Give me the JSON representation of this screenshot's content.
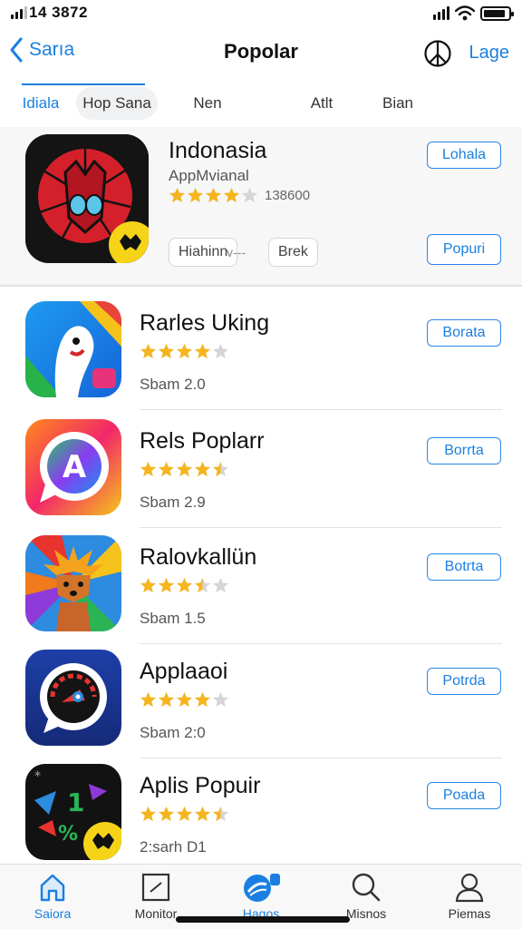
{
  "status_bar": {
    "time": "14 3872",
    "signal_icon": "cellular-icon",
    "wifi_icon": "wifi-icon",
    "battery_icon": "battery-icon",
    "battery_level": 0.9
  },
  "nav": {
    "back_label": "Sarıa",
    "title": "Popolar",
    "right_icon": "peace-icon",
    "right_label": "Lage"
  },
  "tabs": [
    {
      "label": "Idiala",
      "active": true
    },
    {
      "label": "Hop Sana",
      "active": false
    },
    {
      "label": "Nen",
      "active": false
    },
    {
      "label": "Atlt",
      "active": false
    },
    {
      "label": "Bian",
      "active": false
    }
  ],
  "featured": {
    "name": "Indonasia",
    "subtitle": "AppMvianal",
    "rating": 4,
    "rating_count": "138600",
    "chip_1": "Hiahinn",
    "chip_2": "v---",
    "chip_3": "Brek",
    "button_top": "Lohala",
    "button_bottom": "Popuri"
  },
  "apps": [
    {
      "name": "Rarles Uking",
      "rating": 4,
      "meta": "Sbam 2.0",
      "button": "Borata",
      "icon": "ghost-app-icon"
    },
    {
      "name": "Rels Poplarr",
      "rating": 4.5,
      "meta": "Sbam 2.9",
      "button": "Borrta",
      "icon": "chat-a-app-icon"
    },
    {
      "name": "Ralovkallün",
      "rating": 3.5,
      "meta": "Sbam 1.5",
      "button": "Botrta",
      "icon": "fox-app-icon"
    },
    {
      "name": "Applaaoi",
      "rating": 4,
      "meta": "Sbam 2:0",
      "button": "Potrda",
      "icon": "speedometer-app-icon"
    },
    {
      "name": "Aplis Popuir",
      "rating": 4.5,
      "meta": "2:sarh D1",
      "button": "Poada",
      "icon": "game-app-icon"
    }
  ],
  "tabbar": [
    {
      "label": "Saiora",
      "icon": "home-icon",
      "active": true
    },
    {
      "label": "Monitor",
      "icon": "frame-icon",
      "active": false
    },
    {
      "label": "Hagos",
      "icon": "apps-icon",
      "active": false,
      "badge": "8"
    },
    {
      "label": "Misnos",
      "icon": "search-icon",
      "active": false
    },
    {
      "label": "Piemas",
      "icon": "profile-icon",
      "active": false
    }
  ],
  "colors": {
    "accent": "#1a7fe0",
    "star": "#f6b51e",
    "star_empty": "#d5d5d8"
  }
}
